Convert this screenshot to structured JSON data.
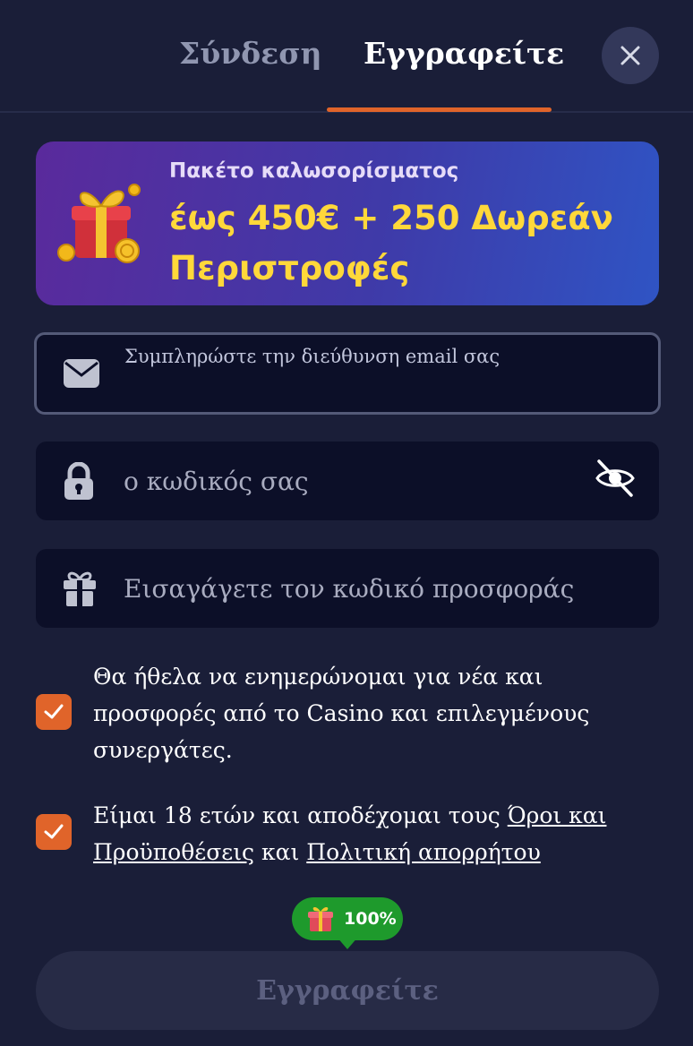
{
  "tabs": {
    "login": "Σύνδεση",
    "register": "Εγγραφείτε"
  },
  "close_icon": "close-icon",
  "banner": {
    "subtitle": "Πακέτο καλωσορίσματος",
    "title": "έως 450€ + 250 Δωρεάν Περιστροφές",
    "icon": "gift-icon"
  },
  "form": {
    "email": {
      "label": "Συμπληρώστε την διεύθυνση email σας",
      "value": "",
      "icon": "envelope-icon"
    },
    "password": {
      "placeholder": "ο κωδικός σας",
      "icon": "lock-icon",
      "toggle_icon": "eye-off-icon"
    },
    "promo": {
      "placeholder": "Εισαγάγετε τον κωδικό προσφοράς",
      "icon": "gift-icon"
    }
  },
  "consents": {
    "news": {
      "text": "Θα ήθελα να ενημερώνομαι για νέα και προσφορές από το Casino και επιλεγμένους συνεργάτες.",
      "checked": true
    },
    "terms": {
      "prefix": "Είμαι 18 ετών και αποδέχομαι τους ",
      "terms_link": "Όροι και Προϋποθέσεις",
      "middle": " και ",
      "privacy_link": "Πολιτική απορρήτου",
      "checked": true
    }
  },
  "progress": {
    "label": "100%",
    "value": 1.0,
    "icon": "gift-icon"
  },
  "submit": {
    "label": "Εγγραφείτε"
  },
  "colors": {
    "background": "#1a1e38",
    "accent": "#e0642a",
    "banner_text": "#ffd83a",
    "badge": "#1e9a2c",
    "field": "#0c0f28"
  }
}
